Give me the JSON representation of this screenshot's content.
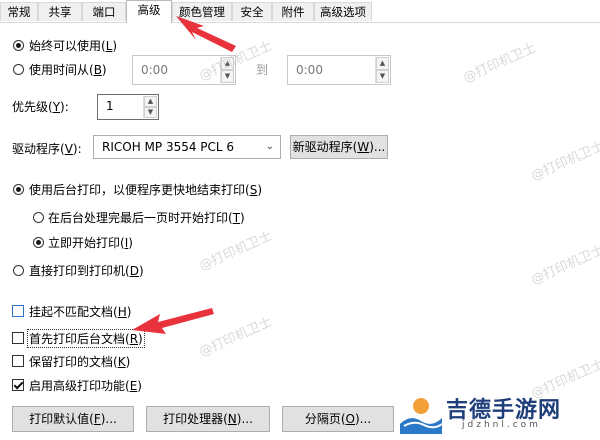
{
  "tabs": [
    {
      "label": "常规"
    },
    {
      "label": "共享"
    },
    {
      "label": "端口"
    },
    {
      "label": "高级"
    },
    {
      "label": "颜色管理"
    },
    {
      "label": "安全"
    },
    {
      "label": "附件"
    },
    {
      "label": "高级选项"
    }
  ],
  "availability": {
    "always_label": "始终可以使用(",
    "always_key": "L",
    "from_label": "使用时间从(",
    "from_key": "B",
    "from_time": "0:00",
    "to_label": "到",
    "to_time": "0:00"
  },
  "priority": {
    "label": "优先级(",
    "key": "Y",
    "value": "1"
  },
  "driver": {
    "label": "驱动程序(",
    "key": "V",
    "value": "RICOH MP 3554 PCL 6",
    "new_button": "新驱动程序(",
    "new_key": "W"
  },
  "spool": {
    "spool_label": "使用后台打印，以便程序更快地结束打印(",
    "spool_key": "S",
    "after_last_label": "在后台处理完最后一页时开始打印(",
    "after_last_key": "T",
    "immediately_label": "立即开始打印(",
    "immediately_key": "I",
    "direct_label": "直接打印到打印机(",
    "direct_key": "D"
  },
  "options": {
    "hold_label": "挂起不匹配文档(",
    "hold_key": "H",
    "spooled_first_label": "首先打印后台文档(",
    "spooled_first_key": "R",
    "keep_label": "保留打印的文档(",
    "keep_key": "K",
    "advanced_label": "启用高级打印功能(",
    "advanced_key": "E",
    "advanced_checked": true
  },
  "buttons": {
    "defaults": "打印默认值(",
    "defaults_key": "F",
    "processor": "打印处理器(",
    "processor_key": "N",
    "separator": "分隔页(",
    "separator_key": "O",
    "ellipsis": ")..."
  },
  "watermark": {
    "text": "@打印机卫士"
  },
  "logo": {
    "name": "吉德手游网",
    "url": "jdzhnl.com"
  },
  "colors": {
    "arrow": "#e8323c",
    "accent": "#2f72c9"
  }
}
